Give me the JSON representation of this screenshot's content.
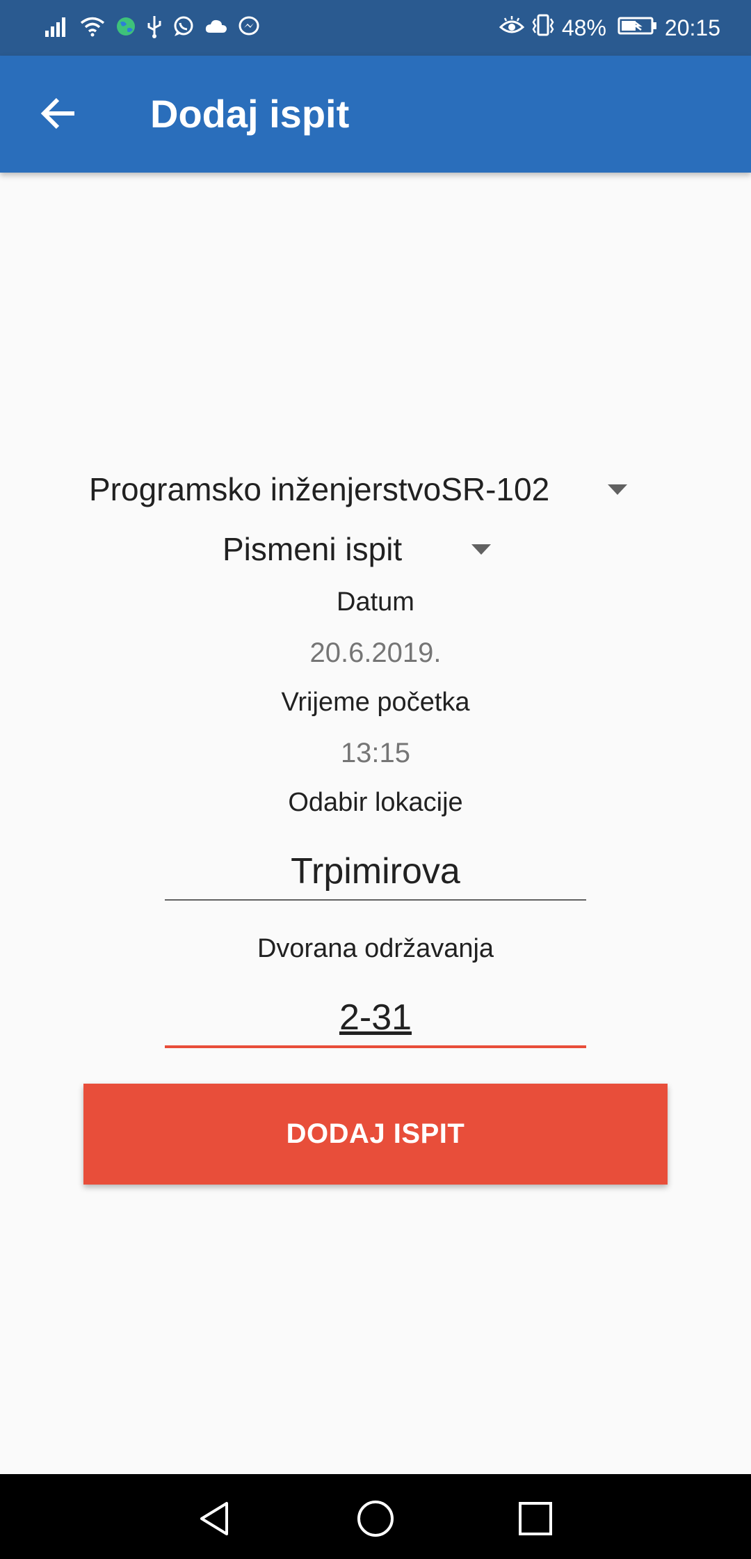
{
  "status_bar": {
    "battery": "48%",
    "time": "20:15",
    "left_icons": [
      "signal-icon",
      "wifi-icon",
      "globe-icon",
      "usb-icon",
      "whatsapp-icon",
      "cloud-icon",
      "messenger-icon"
    ],
    "right_icons": [
      "eye-icon",
      "vibrate-icon",
      "battery-icon"
    ]
  },
  "app_bar": {
    "title": "Dodaj ispit",
    "back_icon": "arrow-back-icon"
  },
  "form": {
    "course_spinner": "Programsko inženjerstvoSR-102",
    "exam_type_spinner": "Pismeni ispit",
    "date_label": "Datum",
    "date_value": "20.6.2019.",
    "time_label": "Vrijeme početka",
    "time_value": "13:15",
    "location_label": "Odabir lokacije",
    "location_value": "Trpimirova",
    "hall_label": "Dvorana održavanja",
    "hall_value": "2-31",
    "submit_label": "DODAJ ISPIT"
  },
  "colors": {
    "status_bar": "#2a5a90",
    "app_bar": "#2a6ebb",
    "accent": "#e84e3a",
    "background": "#fafafa"
  },
  "nav_bar": [
    "back-triangle-icon",
    "home-circle-icon",
    "recents-square-icon"
  ]
}
